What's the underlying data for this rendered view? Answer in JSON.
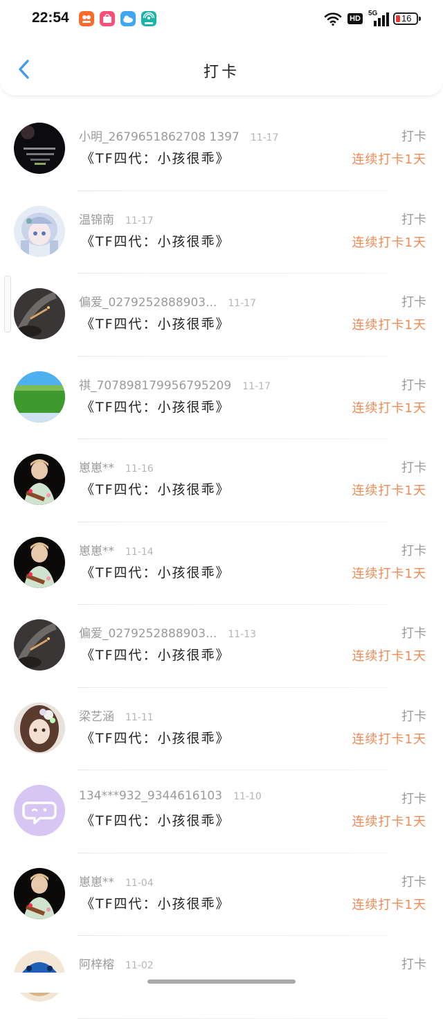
{
  "status_bar": {
    "time": "22:54",
    "network": "5G",
    "hd": "HD",
    "battery": "16"
  },
  "nav": {
    "title": "打卡"
  },
  "colors": {
    "accent_back": "#3d9bea",
    "streak": "#ef8a55"
  },
  "records": [
    {
      "user": "小明_2679651862708 1397",
      "date": "11-17",
      "book": "《TF四代：小孩很乖》",
      "type": "打卡",
      "streak": "连续打卡1天",
      "avatar": "dark-poster"
    },
    {
      "user": "温锦南",
      "date": "11-17",
      "book": "《TF四代：小孩很乖》",
      "type": "打卡",
      "streak": "连续打卡1天",
      "avatar": "anime-girl"
    },
    {
      "user": "偏爱_0279252888903...",
      "date": "11-17",
      "book": "《TF四代：小孩很乖》",
      "type": "打卡",
      "streak": "连续打卡1天",
      "avatar": "smoke-dark"
    },
    {
      "user": "祺_707898179956795209",
      "date": "11-17",
      "book": "《TF四代：小孩很乖》",
      "type": "打卡",
      "streak": "连续打卡1天",
      "avatar": "grassland"
    },
    {
      "user": "崽崽**",
      "date": "11-16",
      "book": "《TF四代：小孩很乖》",
      "type": "打卡",
      "streak": "连续打卡1天",
      "avatar": "guitar-boy"
    },
    {
      "user": "崽崽**",
      "date": "11-14",
      "book": "《TF四代：小孩很乖》",
      "type": "打卡",
      "streak": "连续打卡1天",
      "avatar": "guitar-boy"
    },
    {
      "user": "偏爱_0279252888903...",
      "date": "11-13",
      "book": "《TF四代：小孩很乖》",
      "type": "打卡",
      "streak": "连续打卡1天",
      "avatar": "smoke-dark"
    },
    {
      "user": "梁艺涵",
      "date": "11-11",
      "book": "《TF四代：小孩很乖》",
      "type": "打卡",
      "streak": "连续打卡1天",
      "avatar": "flower-girl"
    },
    {
      "user": "134***932_9344616103",
      "date": "11-10",
      "book": "《TF四代：小孩很乖》",
      "type": "打卡",
      "streak": "连续打卡1天",
      "avatar": "purple-chat"
    },
    {
      "user": "崽崽**",
      "date": "11-04",
      "book": "《TF四代：小孩很乖》",
      "type": "打卡",
      "streak": "连续打卡1天",
      "avatar": "guitar-boy"
    },
    {
      "user": "阿梓榕",
      "date": "11-02",
      "book": "",
      "type": "打卡",
      "streak": "",
      "avatar": "blue-hat"
    }
  ]
}
